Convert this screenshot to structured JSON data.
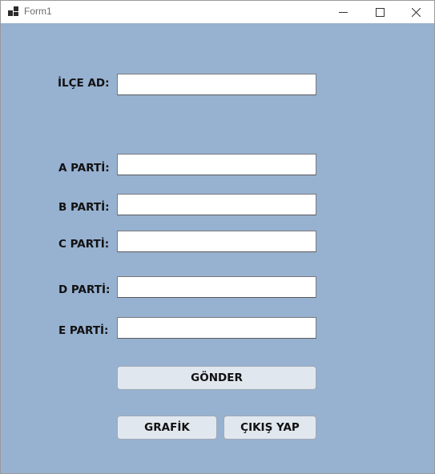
{
  "window": {
    "title": "Form1",
    "controls": {
      "minimize_icon": "minimize-icon",
      "maximize_icon": "maximize-icon",
      "close_icon": "close-icon"
    },
    "background_color": "#97b1d0"
  },
  "form": {
    "district": {
      "label": "İLÇE AD:",
      "value": ""
    },
    "parties": [
      {
        "label": "A PARTİ:",
        "value": ""
      },
      {
        "label": "B PARTİ:",
        "value": ""
      },
      {
        "label": "C PARTİ:",
        "value": ""
      },
      {
        "label": "D PARTİ:",
        "value": ""
      },
      {
        "label": "E PARTİ:",
        "value": ""
      }
    ]
  },
  "buttons": {
    "submit": "GÖNDER",
    "chart": "GRAFİK",
    "exit": "ÇIKIŞ YAP"
  }
}
